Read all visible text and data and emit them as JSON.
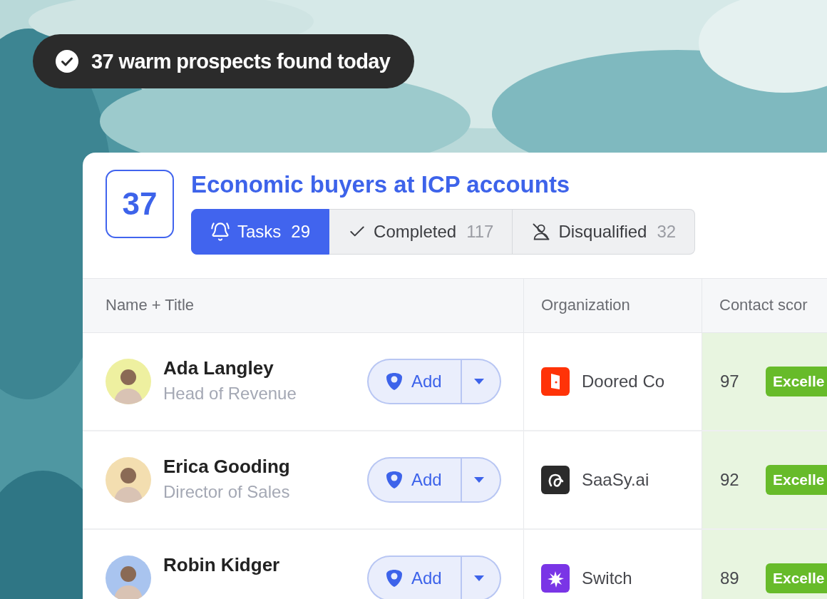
{
  "toast": {
    "message": "37 warm prospects found today"
  },
  "list": {
    "count": "37",
    "title": "Economic buyers at ICP accounts"
  },
  "tabs": [
    {
      "kind": "tasks",
      "label": "Tasks",
      "count": "29",
      "selected": true
    },
    {
      "kind": "completed",
      "label": "Completed",
      "count": "117",
      "selected": false
    },
    {
      "kind": "disqualified",
      "label": "Disqualified",
      "count": "32",
      "selected": false
    }
  ],
  "table": {
    "columns": [
      "Name + Title",
      "Organization",
      "Contact scor"
    ],
    "rows": [
      {
        "avatar": {
          "color": "#eef0a0"
        },
        "name": "Ada Langley",
        "title": "Head of Revenue",
        "action": "Add",
        "org": {
          "kind": "door",
          "name": "Doored Co"
        },
        "score": "97",
        "rating": "Excelle"
      },
      {
        "avatar": {
          "color": "#f3deb0"
        },
        "name": "Erica Gooding",
        "title": "Director of Sales",
        "action": "Add",
        "org": {
          "kind": "loop",
          "name": "SaaSy.ai"
        },
        "score": "92",
        "rating": "Excelle"
      },
      {
        "avatar": {
          "color": "#a9c4ef"
        },
        "name": "Robin Kidger",
        "action": "Add",
        "org": {
          "kind": "splash",
          "name": "Switch"
        },
        "score": "89",
        "rating": "Excelle"
      }
    ]
  }
}
